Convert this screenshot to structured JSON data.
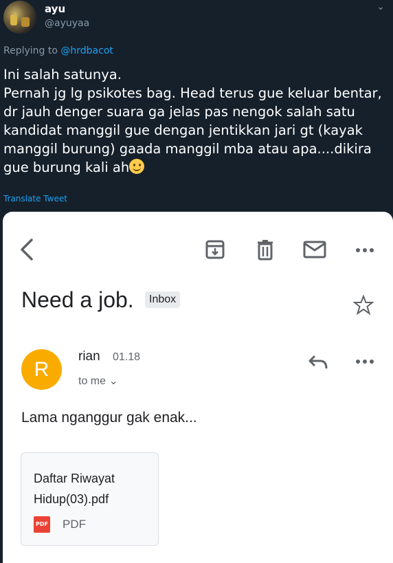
{
  "tweet": {
    "display_name": "ayu",
    "handle": "@ayuyaa",
    "replying_prefix": "Replying to ",
    "replying_mention": "@hrdbacot",
    "text": "Ini salah satunya.\nPernah jg lg psikotes bag. Head terus gue keluar bentar, dr jauh denger suara ga jelas pas nengok salah satu kandidat manggil gue dengan jentikkan jari gt (kayak manggil burung) gaada manggil mba atau apa....dikira gue burung kali ah",
    "emoji": "slightly-smiling-face",
    "translate_label": "Translate Tweet",
    "colors": {
      "background": "#15202b",
      "link": "#1da1f2",
      "secondary": "#8899a6"
    }
  },
  "email": {
    "subject": "Need a job.",
    "label_badge": "Inbox",
    "sender_initial": "R",
    "sender_name": "rian",
    "time": "01.18",
    "recipient": "to me",
    "body": "Lama nganggur gak enak...",
    "attachment": {
      "name": "Daftar Riwayat Hidup(03).pdf",
      "type_icon_text": "PDF",
      "type_label": "PDF"
    },
    "colors": {
      "avatar": "#f9ab00",
      "pdf": "#ea4335"
    },
    "icons": [
      "back-icon",
      "archive-icon",
      "trash-icon",
      "mail-icon",
      "more-icon",
      "star-icon",
      "reply-icon",
      "chevron-down-icon"
    ]
  }
}
